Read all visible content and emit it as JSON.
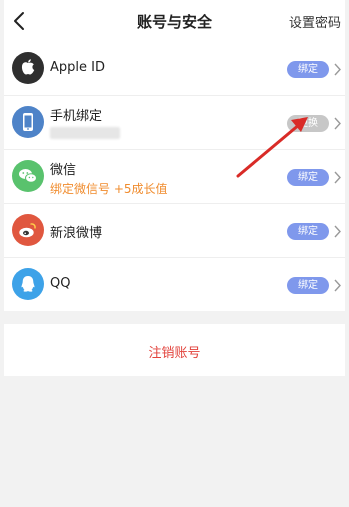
{
  "header": {
    "title": "账号与安全",
    "right_action": "设置密码"
  },
  "accounts": [
    {
      "label": "Apple ID",
      "sub": "",
      "action": "绑定",
      "action_style": "blue",
      "icon": "apple-icon"
    },
    {
      "label": "手机绑定",
      "sub": "",
      "action": "更换",
      "action_style": "gray",
      "icon": "phone-icon"
    },
    {
      "label": "微信",
      "sub": "绑定微信号 +5成长值",
      "action": "绑定",
      "action_style": "blue",
      "icon": "wechat-icon"
    },
    {
      "label": "新浪微博",
      "sub": "",
      "action": "绑定",
      "action_style": "blue",
      "icon": "weibo-icon"
    },
    {
      "label": "QQ",
      "sub": "",
      "action": "绑定",
      "action_style": "blue",
      "icon": "qq-icon"
    }
  ],
  "cancel_account": "注销账号",
  "colors": {
    "accent_blue": "#7f98ec",
    "gray_pill": "#c7c7c7",
    "orange_text": "#f08c2e",
    "danger": "#e2433c",
    "annotation_arrow": "#d92b27"
  }
}
